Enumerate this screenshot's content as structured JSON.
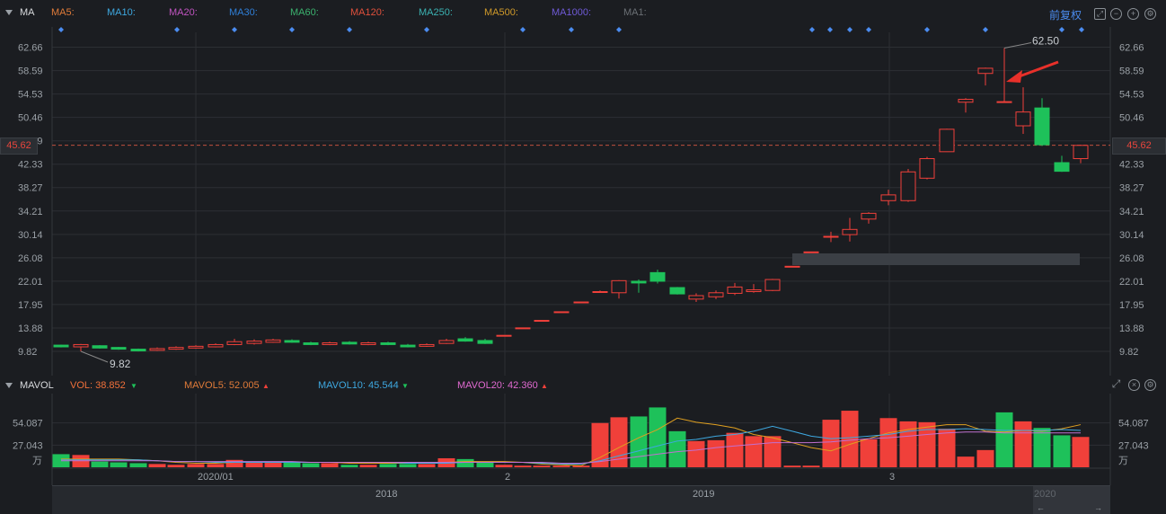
{
  "ma_bar": {
    "title": "MA",
    "items": [
      {
        "label": "MA5:",
        "color": "#e07b39"
      },
      {
        "label": "MA10:",
        "color": "#3ea8e0"
      },
      {
        "label": "MA20:",
        "color": "#c154c1"
      },
      {
        "label": "MA30:",
        "color": "#2f7fd8"
      },
      {
        "label": "MA60:",
        "color": "#3bb26e"
      },
      {
        "label": "MA120:",
        "color": "#e0503c"
      },
      {
        "label": "MA250:",
        "color": "#3bb2b2"
      },
      {
        "label": "MA500:",
        "color": "#d09a2a"
      },
      {
        "label": "MA1000:",
        "color": "#6f5ad6"
      },
      {
        "label": "MA1:",
        "color": "#6b7075"
      }
    ],
    "adjust_label": "前复权",
    "controls": [
      "minus-circle-icon",
      "plus-circle-icon",
      "settings-icon"
    ]
  },
  "price_axis": {
    "ticks": [
      "62.66",
      "58.59",
      "54.53",
      "50.46",
      "46.39",
      "42.33",
      "38.27",
      "34.21",
      "30.14",
      "26.08",
      "22.01",
      "17.95",
      "13.88",
      "9.82"
    ],
    "current_price": "45.62",
    "high_label": "62.50",
    "low_label": "9.82"
  },
  "volume": {
    "title": "MAVOL",
    "vol": "VOL: 38.852",
    "mavol5": "MAVOL5: 52.005",
    "mavol10": "MAVOL10: 45.544",
    "mavol20": "MAVOL20: 42.360",
    "ticks": [
      "54.087",
      "27.043"
    ],
    "unit": "万",
    "x_labels": [
      "2020/01",
      "2",
      "3"
    ]
  },
  "timeline": {
    "years": [
      "2018",
      "2019",
      "2020"
    ]
  },
  "colors": {
    "up": "#f0403a",
    "down": "#1ec15a",
    "bg": "#1b1d21",
    "grid": "#2c2f34"
  },
  "chart_data": {
    "type": "candlestick",
    "y_range": [
      9.82,
      62.66
    ],
    "candles": [
      {
        "o": 10.9,
        "c": 10.6,
        "h": 11.0,
        "l": 10.5
      },
      {
        "o": 10.6,
        "c": 11.0,
        "h": 11.1,
        "l": 9.82
      },
      {
        "o": 10.8,
        "c": 10.4,
        "h": 10.9,
        "l": 10.3
      },
      {
        "o": 10.5,
        "c": 10.2,
        "h": 10.6,
        "l": 10.1
      },
      {
        "o": 10.2,
        "c": 9.9,
        "h": 10.3,
        "l": 9.8
      },
      {
        "o": 10.0,
        "c": 10.3,
        "h": 10.5,
        "l": 9.9
      },
      {
        "o": 10.2,
        "c": 10.5,
        "h": 10.7,
        "l": 10.1
      },
      {
        "o": 10.4,
        "c": 10.7,
        "h": 10.9,
        "l": 10.3
      },
      {
        "o": 10.6,
        "c": 11.0,
        "h": 11.2,
        "l": 10.5
      },
      {
        "o": 11.0,
        "c": 11.5,
        "h": 12.0,
        "l": 10.9
      },
      {
        "o": 11.2,
        "c": 11.6,
        "h": 11.9,
        "l": 11.0
      },
      {
        "o": 11.4,
        "c": 11.8,
        "h": 12.0,
        "l": 11.3
      },
      {
        "o": 11.7,
        "c": 11.4,
        "h": 11.9,
        "l": 11.3
      },
      {
        "o": 11.3,
        "c": 11.0,
        "h": 11.5,
        "l": 10.9
      },
      {
        "o": 11.0,
        "c": 11.3,
        "h": 11.5,
        "l": 10.9
      },
      {
        "o": 11.4,
        "c": 11.1,
        "h": 11.6,
        "l": 11.0
      },
      {
        "o": 11.0,
        "c": 11.3,
        "h": 11.5,
        "l": 10.9
      },
      {
        "o": 11.3,
        "c": 11.0,
        "h": 11.5,
        "l": 10.9
      },
      {
        "o": 10.9,
        "c": 10.6,
        "h": 11.1,
        "l": 10.5
      },
      {
        "o": 10.7,
        "c": 11.0,
        "h": 11.2,
        "l": 10.6
      },
      {
        "o": 11.2,
        "c": 11.7,
        "h": 12.0,
        "l": 11.1
      },
      {
        "o": 12.0,
        "c": 11.6,
        "h": 12.3,
        "l": 11.5
      },
      {
        "o": 11.7,
        "c": 11.2,
        "h": 12.0,
        "l": 11.1
      },
      {
        "o": 12.6,
        "c": 12.6,
        "h": 12.6,
        "l": 12.6
      },
      {
        "o": 13.9,
        "c": 13.9,
        "h": 13.9,
        "l": 13.9
      },
      {
        "o": 15.2,
        "c": 15.2,
        "h": 15.2,
        "l": 15.2
      },
      {
        "o": 16.7,
        "c": 16.7,
        "h": 16.7,
        "l": 16.7
      },
      {
        "o": 18.4,
        "c": 18.4,
        "h": 18.4,
        "l": 18.4
      },
      {
        "o": 20.2,
        "c": 20.2,
        "h": 20.4,
        "l": 20.0
      },
      {
        "o": 20.0,
        "c": 22.1,
        "h": 22.2,
        "l": 19.0
      },
      {
        "o": 22.0,
        "c": 21.7,
        "h": 22.3,
        "l": 20.0
      },
      {
        "o": 23.5,
        "c": 22.0,
        "h": 24.0,
        "l": 21.6
      },
      {
        "o": 20.9,
        "c": 19.8,
        "h": 21.0,
        "l": 19.7
      },
      {
        "o": 18.9,
        "c": 19.5,
        "h": 19.9,
        "l": 18.4
      },
      {
        "o": 19.3,
        "c": 20.0,
        "h": 20.4,
        "l": 18.9
      },
      {
        "o": 19.9,
        "c": 21.0,
        "h": 21.7,
        "l": 19.6
      },
      {
        "o": 20.2,
        "c": 20.5,
        "h": 21.5,
        "l": 20.0
      },
      {
        "o": 20.4,
        "c": 22.3,
        "h": 22.4,
        "l": 20.3
      },
      {
        "o": 24.6,
        "c": 24.6,
        "h": 24.6,
        "l": 24.6
      },
      {
        "o": 27.1,
        "c": 27.1,
        "h": 27.1,
        "l": 27.1
      },
      {
        "o": 29.8,
        "c": 29.8,
        "h": 30.6,
        "l": 28.8
      },
      {
        "o": 30.1,
        "c": 31.0,
        "h": 33.0,
        "l": 28.9
      },
      {
        "o": 32.8,
        "c": 33.8,
        "h": 34.0,
        "l": 32.0
      },
      {
        "o": 36.0,
        "c": 37.0,
        "h": 37.9,
        "l": 35.2
      },
      {
        "o": 36.0,
        "c": 41.0,
        "h": 41.5,
        "l": 35.8
      },
      {
        "o": 39.9,
        "c": 43.3,
        "h": 43.6,
        "l": 39.7
      },
      {
        "o": 44.5,
        "c": 48.4,
        "h": 48.5,
        "l": 44.5
      },
      {
        "o": 53.1,
        "c": 53.6,
        "h": 53.8,
        "l": 51.3
      },
      {
        "o": 58.1,
        "c": 59.0,
        "h": 59.1,
        "l": 56.0
      },
      {
        "o": 53.2,
        "c": 53.2,
        "h": 62.5,
        "l": 53.2
      },
      {
        "o": 49.0,
        "c": 51.4,
        "h": 55.7,
        "l": 47.6
      },
      {
        "o": 52.1,
        "c": 45.7,
        "h": 53.8,
        "l": 45.5
      },
      {
        "o": 42.6,
        "c": 41.1,
        "h": 43.8,
        "l": 41.0
      },
      {
        "o": 43.3,
        "c": 45.6,
        "h": 45.7,
        "l": 42.5
      }
    ],
    "volumes": [
      {
        "v": 16,
        "up": false
      },
      {
        "v": 15,
        "up": true
      },
      {
        "v": 7,
        "up": false
      },
      {
        "v": 6,
        "up": false
      },
      {
        "v": 5,
        "up": false
      },
      {
        "v": 4,
        "up": true
      },
      {
        "v": 3,
        "up": true
      },
      {
        "v": 4,
        "up": true
      },
      {
        "v": 4,
        "up": true
      },
      {
        "v": 9,
        "up": true
      },
      {
        "v": 7,
        "up": true
      },
      {
        "v": 6,
        "up": true
      },
      {
        "v": 6,
        "up": false
      },
      {
        "v": 5,
        "up": false
      },
      {
        "v": 5,
        "up": true
      },
      {
        "v": 3,
        "up": false
      },
      {
        "v": 3,
        "up": true
      },
      {
        "v": 4,
        "up": false
      },
      {
        "v": 4,
        "up": false
      },
      {
        "v": 4,
        "up": true
      },
      {
        "v": 11,
        "up": true
      },
      {
        "v": 10,
        "up": false
      },
      {
        "v": 6,
        "up": false
      },
      {
        "v": 3,
        "up": true
      },
      {
        "v": 2,
        "up": true
      },
      {
        "v": 2,
        "up": true
      },
      {
        "v": 2,
        "up": true
      },
      {
        "v": 2,
        "up": true
      },
      {
        "v": 54,
        "up": true
      },
      {
        "v": 61,
        "up": true
      },
      {
        "v": 62,
        "up": false
      },
      {
        "v": 73,
        "up": false
      },
      {
        "v": 44,
        "up": false
      },
      {
        "v": 32,
        "up": true
      },
      {
        "v": 33,
        "up": true
      },
      {
        "v": 42,
        "up": true
      },
      {
        "v": 38,
        "up": true
      },
      {
        "v": 38,
        "up": true
      },
      {
        "v": 2,
        "up": true
      },
      {
        "v": 2,
        "up": true
      },
      {
        "v": 58,
        "up": true
      },
      {
        "v": 69,
        "up": true
      },
      {
        "v": 34,
        "up": true
      },
      {
        "v": 60,
        "up": true
      },
      {
        "v": 56,
        "up": true
      },
      {
        "v": 55,
        "up": true
      },
      {
        "v": 47,
        "up": true
      },
      {
        "v": 13,
        "up": true
      },
      {
        "v": 21,
        "up": true
      },
      {
        "v": 67,
        "up": false
      },
      {
        "v": 56,
        "up": true
      },
      {
        "v": 48,
        "up": false
      },
      {
        "v": 39,
        "up": false
      },
      {
        "v": 37,
        "up": true
      }
    ],
    "vol_range": [
      0,
      81.13
    ],
    "ma_lines": {
      "mavol5": [
        10,
        10,
        10,
        10,
        9,
        8,
        6,
        5,
        5,
        6,
        6,
        6,
        6,
        6,
        6,
        5,
        5,
        5,
        5,
        5,
        6,
        7,
        7,
        7,
        6,
        4,
        3,
        2,
        12,
        24,
        36,
        46,
        60,
        55,
        52,
        48,
        40,
        36,
        30,
        24,
        20,
        28,
        35,
        42,
        46,
        49,
        52,
        52,
        44,
        43,
        45,
        44,
        47,
        52
      ],
      "mavol10": [
        9,
        9,
        9,
        9,
        9,
        8,
        7,
        7,
        6,
        6,
        6,
        6,
        6,
        6,
        6,
        6,
        6,
        6,
        5,
        5,
        5,
        6,
        6,
        6,
        6,
        5,
        4,
        4,
        8,
        14,
        20,
        26,
        32,
        34,
        38,
        40,
        44,
        50,
        44,
        38,
        35,
        36,
        38,
        40,
        44,
        46,
        46,
        47,
        46,
        45,
        45,
        45,
        46,
        45
      ],
      "mavol20": [
        8,
        8,
        8,
        8,
        8,
        8,
        7,
        7,
        7,
        7,
        7,
        7,
        7,
        6,
        6,
        6,
        6,
        6,
        6,
        6,
        6,
        6,
        6,
        6,
        6,
        6,
        5,
        5,
        7,
        10,
        13,
        16,
        19,
        21,
        24,
        26,
        28,
        30,
        30,
        30,
        31,
        33,
        35,
        36,
        38,
        40,
        42,
        43,
        43,
        42,
        42,
        42,
        42,
        42
      ]
    }
  }
}
